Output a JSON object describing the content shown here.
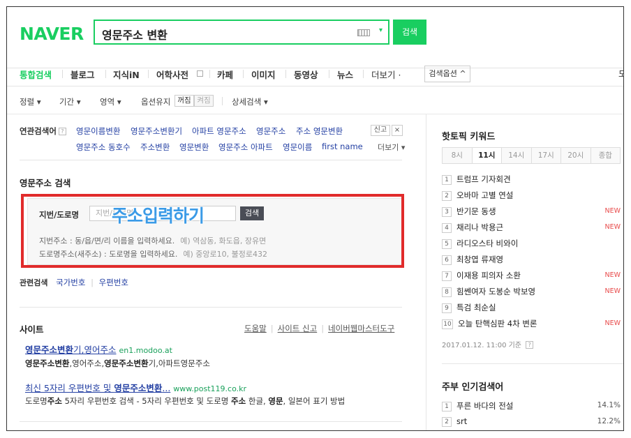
{
  "header": {
    "logo": "NAVER",
    "query": "영문주소 변환",
    "search_button": "검색"
  },
  "tabs": [
    {
      "label": "통합검색",
      "active": true
    },
    {
      "label": "블로그"
    },
    {
      "label": "지식iN"
    },
    {
      "label": "어학사전"
    },
    {
      "label": "카페"
    },
    {
      "label": "이미지"
    },
    {
      "label": "동영상"
    },
    {
      "label": "뉴스"
    },
    {
      "label": "더보기 ·"
    }
  ],
  "search_options": "검색옵션 ^",
  "tabs_edge_text": "도",
  "filters": {
    "sort": "정렬 ▾",
    "period": "기간 ▾",
    "area": "영역 ▾",
    "keep_option": "옵션유지",
    "on": "꺼짐",
    "off": "켜짐",
    "detail": "상세검색 ▾"
  },
  "related": {
    "label": "연관검색어",
    "row1": [
      "영문이름변환",
      "영문주소변환기",
      "아파트 영문주소",
      "영문주소",
      "주소 영문변환"
    ],
    "row2": [
      "영문주소 동호수",
      "주소변환",
      "영문변환",
      "영문주소 아파트",
      "영문이름",
      "first name"
    ],
    "report": "신고",
    "close": "×",
    "more": "더보기 ▾"
  },
  "address_search": {
    "title": "영문주소 검색",
    "field_label": "지번/도로명",
    "placeholder": "지번/도로명",
    "button": "검색",
    "hint1": "지번주소 : 동/읍/면/리 이름을 입력하세요.",
    "hint1_example": "예) 역삼동, 화도읍, 장유면",
    "hint2": "도로명주소(새주소) : 도로명을 입력하세요.",
    "hint2_example": "예) 중앙로10, 불정로432",
    "overlay": "주소입력하기"
  },
  "related_search": {
    "label": "관련검색",
    "links": [
      "국가번호",
      "우편번호"
    ]
  },
  "site": {
    "title": "사이트",
    "links": [
      "도움말",
      "사이트 신고",
      "네이버웹마스터도구"
    ],
    "results": [
      {
        "title_bold": "영문주소변환",
        "title_rest": "기,영어주소",
        "url": "en1.modoo.at",
        "desc_b1": "영문주소변환",
        "desc_m1": ",영어주소,",
        "desc_b2": "영문주소변환",
        "desc_m2": "기,아파트영문주소"
      },
      {
        "title_pre": "최신 5자리 우편번호 및 ",
        "title_bold": "영문주소변환",
        "title_rest": "...",
        "url": "www.post119.co.kr",
        "desc_p1": "도로명",
        "desc_b1": "주소",
        "desc_p2": " 5자리 우편번호 검색 - 5자리 우편번호 및 도로명 ",
        "desc_b2": "주소",
        "desc_p3": " 한글, ",
        "desc_b3": "영문",
        "desc_p4": ", 일본어 표기 방법"
      }
    ]
  },
  "hot_topics": {
    "title": "핫토픽 키워드",
    "time_tabs": [
      "8시",
      "11시",
      "14시",
      "17시",
      "20시",
      "종합"
    ],
    "active_tab": "11시",
    "items": [
      {
        "rank": "1",
        "text": "트럼프 기자회견",
        "badge": ""
      },
      {
        "rank": "2",
        "text": "오바마 고별 연설",
        "badge": ""
      },
      {
        "rank": "3",
        "text": "반기문 동생",
        "badge": "NEW"
      },
      {
        "rank": "4",
        "text": "채리나 박용근",
        "badge": "NEW"
      },
      {
        "rank": "5",
        "text": "라디오스타 비와이",
        "badge": ""
      },
      {
        "rank": "6",
        "text": "최창엽 류재영",
        "badge": ""
      },
      {
        "rank": "7",
        "text": "이재용 피의자 소환",
        "badge": "NEW"
      },
      {
        "rank": "8",
        "text": "힘쎈여자 도봉순 박보영",
        "badge": "NEW"
      },
      {
        "rank": "9",
        "text": "특검 최순실",
        "badge": ""
      },
      {
        "rank": "10",
        "text": "오늘 탄핵심판 4차 변론",
        "badge": "NEW"
      }
    ],
    "as_of": "2017.01.12. 11:00 기준"
  },
  "popular": {
    "title": "주부 인기검색어",
    "items": [
      {
        "rank": "1",
        "text": "푸른 바다의 전설",
        "pct": "14.1%"
      },
      {
        "rank": "2",
        "text": "srt",
        "pct": "12.2%"
      }
    ]
  }
}
